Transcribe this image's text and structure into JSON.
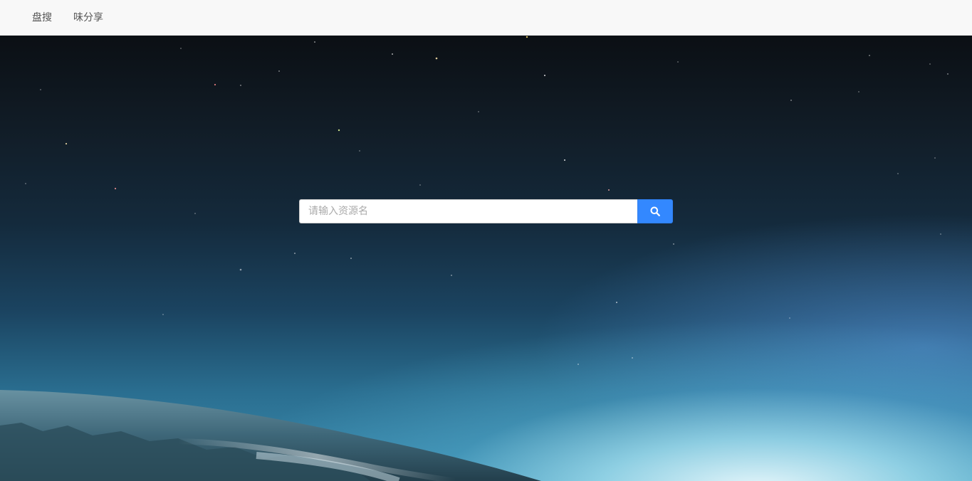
{
  "nav": {
    "items": [
      {
        "label": "盘搜"
      },
      {
        "label": "味分享"
      }
    ]
  },
  "search": {
    "placeholder": "请输入资源名",
    "value": "",
    "button_icon": "search-icon"
  },
  "colors": {
    "navbar_bg": "#f8f8f8",
    "button_bg": "#3388ff",
    "nav_text": "#555555"
  }
}
